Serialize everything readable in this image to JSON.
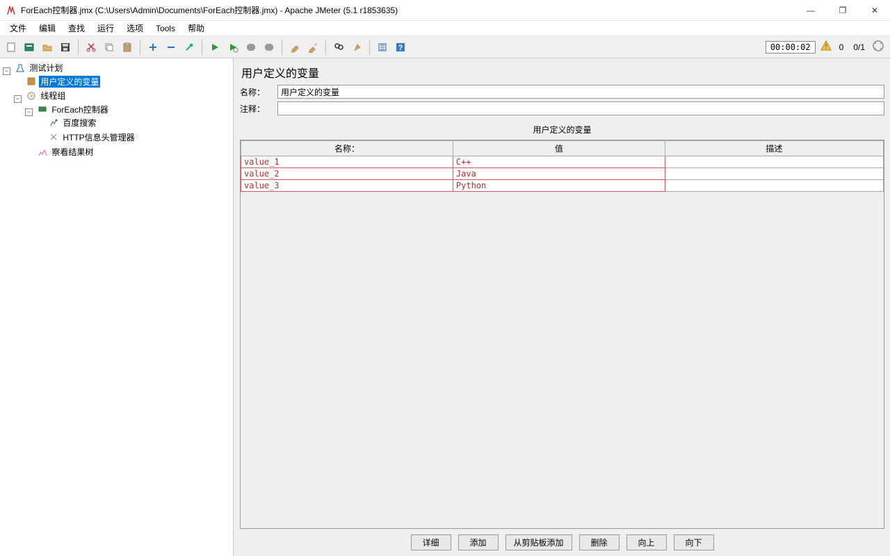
{
  "window": {
    "title": "ForEach控制器.jmx (C:\\Users\\Admin\\Documents\\ForEach控制器.jmx) - Apache JMeter (5.1 r1853635)"
  },
  "menu": {
    "file": "文件",
    "edit": "编辑",
    "search": "查找",
    "run": "运行",
    "options": "选项",
    "tools": "Tools",
    "help": "帮助"
  },
  "toolbar": {
    "icons": {
      "new": "new-file-icon",
      "templates": "templates-icon",
      "open": "open-icon",
      "save": "save-icon",
      "cut": "cut-icon",
      "copy": "copy-icon",
      "paste": "paste-icon",
      "expand": "plus-icon",
      "collapse": "minus-icon",
      "toggle": "toggle-icon",
      "start": "start-icon",
      "start_no_timers": "start-no-timers-icon",
      "stop": "stop-icon",
      "shutdown": "shutdown-icon",
      "clear": "clear-icon",
      "clear_all": "clear-all-icon",
      "search": "search-icon",
      "reset_search": "reset-search-icon",
      "function_helper": "function-helper-icon",
      "help": "help-icon"
    },
    "timer": "00:00:02",
    "warning": "warning-icon",
    "active_threads": "0",
    "total_threads": "0/1",
    "fullscreen": "fullscreen-icon"
  },
  "tree": {
    "test_plan": "测试计划",
    "user_vars": "用户定义的变量",
    "thread_group": "线程组",
    "foreach": "ForEach控制器",
    "baidu": "百度搜索",
    "http_header": "HTTP信息头管理器",
    "view_results": "察看结果树"
  },
  "panel": {
    "title": "用户定义的变量",
    "name_label": "名称：",
    "name_value": "用户定义的变量",
    "comment_label": "注释：",
    "comment_value": "",
    "table_title": "用户定义的变量",
    "col_name": "名称：",
    "col_value": "值",
    "col_desc": "描述",
    "rows": [
      {
        "name": "value_1",
        "value": "C++",
        "desc": ""
      },
      {
        "name": "value_2",
        "value": "Java",
        "desc": ""
      },
      {
        "name": "value_3",
        "value": "Python",
        "desc": ""
      }
    ],
    "buttons": {
      "detail": "详细",
      "add": "添加",
      "add_clipboard": "从剪贴板添加",
      "delete": "删除",
      "up": "向上",
      "down": "向下"
    }
  }
}
